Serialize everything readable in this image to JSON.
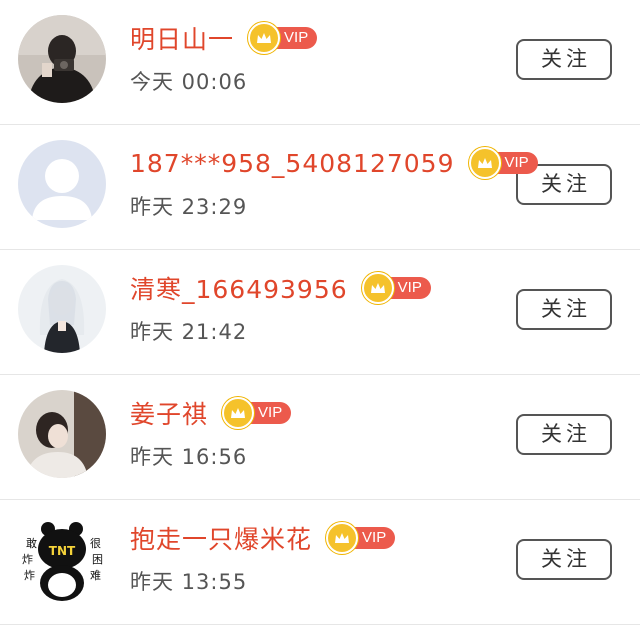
{
  "colors": {
    "name_red": "#e0462b",
    "vip_pill": "#ec5a4c",
    "crown_gold": "#f5c22b",
    "divider": "#e6e6e6"
  },
  "vip_label": "VIP",
  "follow_label": "关注",
  "users": [
    {
      "name": "明日山一",
      "time": "今天 00:06",
      "avatar": "photo-avatar-dark"
    },
    {
      "name": "187***958_5408127059",
      "time": "昨天 23:29",
      "avatar": "default-avatar"
    },
    {
      "name": "清寒_166493956",
      "time": "昨天 21:42",
      "avatar": "anime-girl-avatar"
    },
    {
      "name": "姜子祺",
      "time": "昨天 16:56",
      "avatar": "photo-avatar-light"
    },
    {
      "name": "抱走一只爆米花",
      "time": "昨天 13:55",
      "avatar": "panda-sticker-avatar",
      "avatar_text": [
        "敢",
        "炸",
        "炸",
        "很",
        "困",
        "难",
        "TNT"
      ]
    }
  ]
}
